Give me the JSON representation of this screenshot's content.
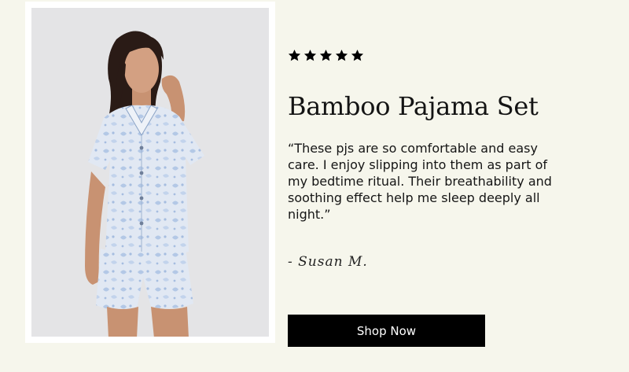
{
  "rating": {
    "stars": 5,
    "max": 5,
    "color": "#000000"
  },
  "product": {
    "title": "Bamboo Pajama Set"
  },
  "review": {
    "quote": "“These pjs are so comfortable and easy care. I enjoy slipping into them as part of my bedtime ritual. Their breathability and soothing effect help me sleep deeply all night.”",
    "author": "- Susan M."
  },
  "cta": {
    "label": "Shop Now"
  },
  "colors": {
    "background": "#f6f6ec",
    "button": "#000000",
    "button_text": "#ffffff",
    "photo_background": "#e4e4e6",
    "pajama": "#dde6f2",
    "pajama_print": "#a9c0e0"
  }
}
